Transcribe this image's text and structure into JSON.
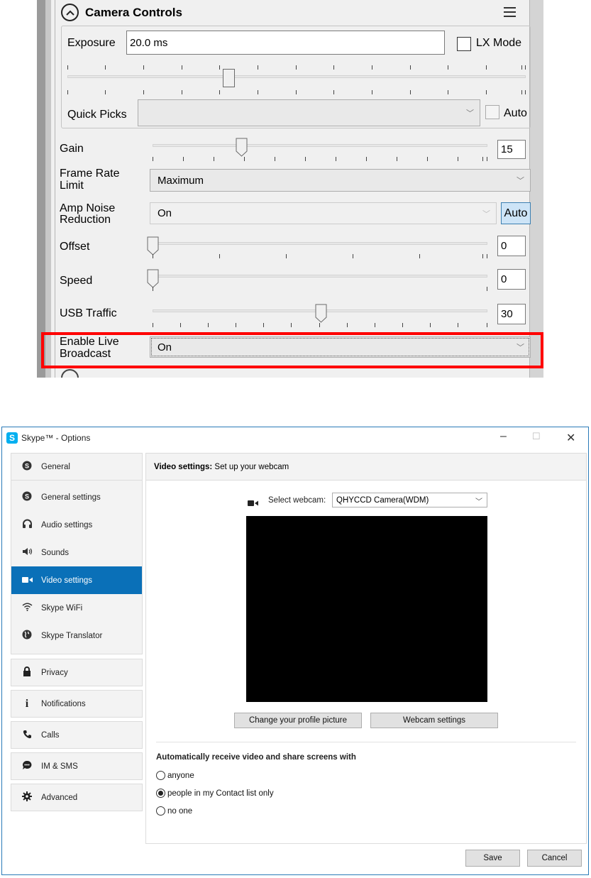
{
  "camera_controls": {
    "title": "Camera Controls",
    "menu_icon": "hamburger-icon",
    "exposure": {
      "label": "Exposure",
      "value": "20.0 ms",
      "slider_fraction": 0.33
    },
    "lx_mode": {
      "label": "LX Mode",
      "checked": false
    },
    "quick_picks": {
      "label": "Quick Picks",
      "value": ""
    },
    "auto_check": {
      "label": "Auto",
      "checked": false
    },
    "gain": {
      "label": "Gain",
      "value": "15",
      "slider_fraction": 0.27
    },
    "frame_rate": {
      "label_line1": "Frame Rate",
      "label_line2": "Limit",
      "value": "Maximum"
    },
    "amp_noise": {
      "label_line1": "Amp Noise",
      "label_line2": "Reduction",
      "value": "On",
      "auto_button": "Auto"
    },
    "offset": {
      "label": "Offset",
      "value": "0",
      "slider_fraction": 0.0
    },
    "speed": {
      "label": "Speed",
      "value": "0",
      "slider_fraction": 0.0
    },
    "usb_traffic": {
      "label": "USB Traffic",
      "value": "30",
      "slider_fraction": 0.5
    },
    "live_broadcast": {
      "label_line1": "Enable Live",
      "label_line2": "Broadcast",
      "value": "On"
    },
    "highlight_color": "#ff0000"
  },
  "skype": {
    "window_title": "Skype™ - Options",
    "controls": {
      "minimize": "–",
      "maximize": "☐",
      "close": "✕"
    },
    "nav": {
      "general_header": "General",
      "general_items": [
        {
          "label": "General settings",
          "icon": "skype-icon"
        },
        {
          "label": "Audio settings",
          "icon": "headset-icon"
        },
        {
          "label": "Sounds",
          "icon": "speaker-icon"
        },
        {
          "label": "Video settings",
          "icon": "video-camera-icon",
          "selected": true
        },
        {
          "label": "Skype WiFi",
          "icon": "wifi-icon"
        },
        {
          "label": "Skype Translator",
          "icon": "globe-icon"
        }
      ],
      "sections": [
        {
          "label": "Privacy",
          "icon": "lock-icon"
        },
        {
          "label": "Notifications",
          "icon": "info-icon"
        },
        {
          "label": "Calls",
          "icon": "phone-icon"
        },
        {
          "label": "IM & SMS",
          "icon": "chat-icon"
        },
        {
          "label": "Advanced",
          "icon": "gear-icon"
        }
      ]
    },
    "header_bold": "Video settings:",
    "header_rest": " Set up your webcam",
    "select_webcam_label": "Select webcam:",
    "webcam_value": "QHYCCD Camera(WDM)",
    "change_picture_button": "Change your profile picture",
    "webcam_settings_button": "Webcam settings",
    "auto_receive_heading": "Automatically receive video and share screens with",
    "radio_options": [
      {
        "label": "anyone",
        "checked": false
      },
      {
        "label": "people in my Contact list only",
        "checked": true
      },
      {
        "label": "no one",
        "checked": false
      }
    ],
    "save_button": "Save",
    "cancel_button": "Cancel",
    "accent_color": "#0a70b8"
  }
}
